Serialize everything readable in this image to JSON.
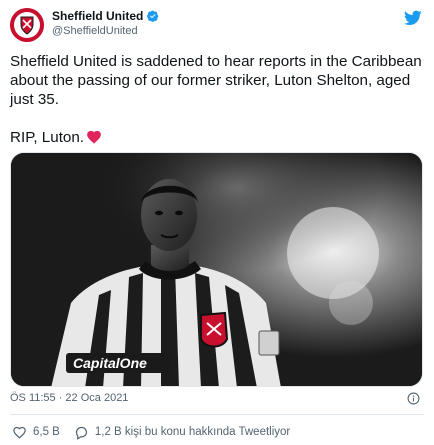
{
  "account": {
    "display_name": "Sheffield United",
    "handle": "@SheffieldUnited",
    "avatar_icon": "club-crest-icon",
    "verified_icon": "verified-badge-icon",
    "brand_icon": "twitter-bird-icon"
  },
  "tweet": {
    "text_line1": "Sheffield United is saddened to hear reports in the Caribbean about the passing of our former striker, Luton Shelton, aged just 35.",
    "text_line2": "RIP, Luton.",
    "heart_icon": "red-heart-emoji"
  },
  "meta": {
    "timestamp": "ÖS 11:55 · 22 Oca 2021",
    "info_icon": "info-icon"
  },
  "actions": {
    "likes_count": "6,5 B",
    "talking_label": "1,2 B kişi bu konu hakkında Tweetliyor"
  },
  "colors": {
    "accent_blue": "#1d9bf0",
    "heart_red": "#e0245e",
    "crest_red": "#c8102e",
    "text_secondary": "#536471"
  }
}
